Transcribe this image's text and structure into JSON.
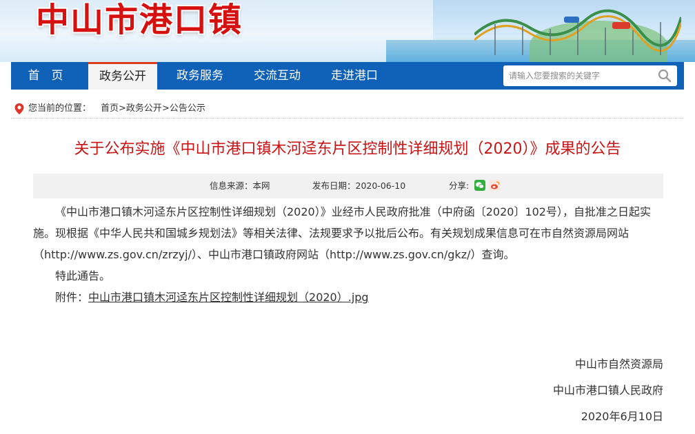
{
  "header": {
    "site_title": "中山市港口镇"
  },
  "nav": {
    "items": [
      {
        "label": "首　页",
        "active": false
      },
      {
        "label": "政务公开",
        "active": true
      },
      {
        "label": "政务服务",
        "active": false
      },
      {
        "label": "交流互动",
        "active": false
      },
      {
        "label": "走进港口",
        "active": false
      }
    ],
    "search_placeholder": "请输入您要搜索的关键字"
  },
  "breadcrumb": {
    "label": "您当前的位置：",
    "items": [
      "首页",
      "政务公开",
      "公告公示"
    ],
    "separator": ">"
  },
  "article": {
    "title": "关于公布实施《中山市港口镇木河迳东片区控制性详细规划（2020）》成果的公告",
    "source_label": "信息来源：本网",
    "date_label": "发布日期：2020-06-10",
    "share_label": "分享:",
    "share_icons": [
      "wechat-icon",
      "weibo-icon"
    ],
    "paragraph1": "《中山市港口镇木河迳东片区控制性详细规划（2020）》业经市人民政府批准（中府函〔2020〕102号），自批准之日起实施。现根据《中华人民共和国城乡规划法》等相关法律、法规要求予以批后公布。有关规划成果信息可在市自然资源局网站（http://www.zs.gov.cn/zrzyj/）、中山市港口镇政府网站（http://www.zs.gov.cn/gkz/）查询。",
    "paragraph2": "特此通告。",
    "attachment_label": "附件：",
    "attachment_link": "中山市港口镇木河迳东片区控制性详细规划（2020）.jpg",
    "signature": [
      "中山市自然资源局",
      "中山市港口镇人民政府",
      "2020年6月10日"
    ]
  },
  "colors": {
    "nav_bg": "#0e61b6",
    "title_red": "#c81414",
    "active_accent": "#e03a1e"
  }
}
